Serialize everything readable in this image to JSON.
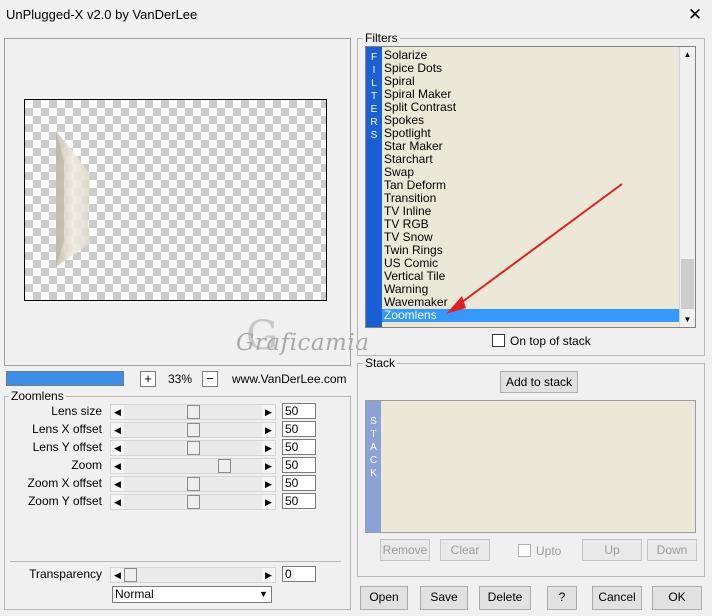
{
  "window": {
    "title": "UnPlugged-X v2.0 by VanDerLee",
    "close_glyph": "✕"
  },
  "preview": {
    "zoom_minus": "−",
    "zoom_plus": "+",
    "zoom_value": "33%",
    "website": "www.VanDerLee.com",
    "progress_fraction": 1.0,
    "watermark": "Graficamia",
    "watermark_initial": "G"
  },
  "zoomlens": {
    "title": "Zoomlens",
    "sliders": [
      {
        "label": "Lens size",
        "value": "50",
        "level": 0.5
      },
      {
        "label": "Lens X offset",
        "value": "50",
        "level": 0.5
      },
      {
        "label": "Lens Y offset",
        "value": "50",
        "level": 0.5
      },
      {
        "label": "Zoom",
        "value": "50",
        "level": 0.75
      },
      {
        "label": "Zoom X offset",
        "value": "50",
        "level": 0.5
      },
      {
        "label": "Zoom Y offset",
        "value": "50",
        "level": 0.5
      }
    ],
    "transparency": {
      "label": "Transparency",
      "value": "0",
      "level": 0.0
    },
    "blend_mode": "Normal"
  },
  "filters": {
    "title": "Filters",
    "sidebar_letters": [
      "F",
      "I",
      "L",
      "T",
      "E",
      "R",
      "S"
    ],
    "items": [
      "Solarize",
      "Spice Dots",
      "Spiral",
      "Spiral Maker",
      "Split Contrast",
      "Spokes",
      "Spotlight",
      "Star Maker",
      "Starchart",
      "Swap",
      "Tan Deform",
      "Transition",
      "TV Inline",
      "TV RGB",
      "TV Snow",
      "Twin Rings",
      "US Comic",
      "Vertical Tile",
      "Warning",
      "Wavemaker",
      "Zoomlens"
    ],
    "selected": "Zoomlens",
    "on_top_of_stack": "On top of stack"
  },
  "stack": {
    "title": "Stack",
    "add_button": "Add to stack",
    "sidebar_letters": [
      "S",
      "T",
      "A",
      "C",
      "K"
    ],
    "remove": "Remove",
    "clear": "Clear",
    "upto": "Upto",
    "up": "Up",
    "down": "Down"
  },
  "footer": {
    "open": "Open",
    "save": "Save",
    "delete": "Delete",
    "help": "?",
    "cancel": "Cancel",
    "ok": "OK"
  },
  "colors": {
    "accent": "#1a5fd4",
    "selection": "#3399ff",
    "arrow": "#e02020",
    "list_bg": "#ece8d8"
  }
}
